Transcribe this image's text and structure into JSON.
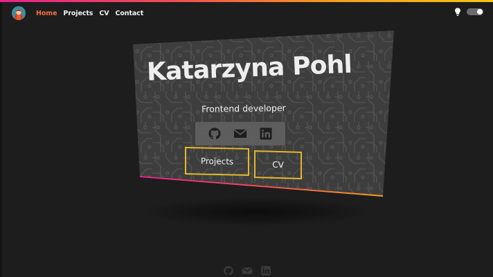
{
  "nav": {
    "avatar": "avatar-illustration",
    "links": [
      {
        "label": "Home",
        "active": true
      },
      {
        "label": "Projects",
        "active": false
      },
      {
        "label": "CV",
        "active": false
      },
      {
        "label": "Contact",
        "active": false
      }
    ],
    "theme_icon": "lightbulb-icon",
    "theme_toggle_on": true
  },
  "hero": {
    "name": "Katarzyna Pohl",
    "role": "Frontend developer",
    "social_icons": [
      "github-icon",
      "mail-icon",
      "linkedin-icon"
    ],
    "buttons": {
      "projects": "Projects",
      "cv": "CV"
    }
  },
  "footer": {
    "icons": [
      "github-icon",
      "mail-icon",
      "linkedin-icon"
    ]
  },
  "colors": {
    "background": "#1d1d1d",
    "accent_orange": "#f76b3a",
    "button_border": "#e5b92a",
    "gradient_pink": "#e6218f",
    "gradient_yellow": "#f6c514"
  }
}
